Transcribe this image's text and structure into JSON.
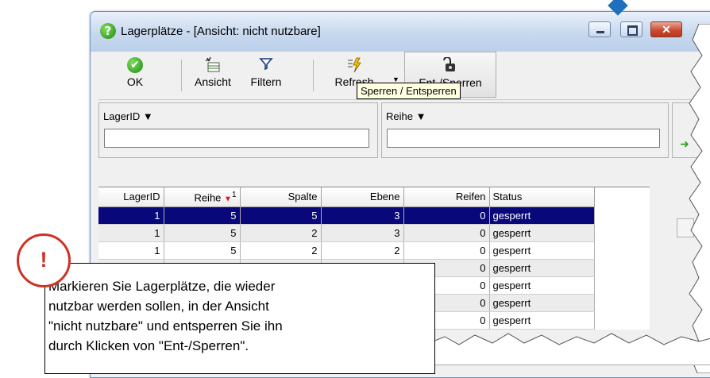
{
  "window": {
    "title": "Lagerplätze  -  [Ansicht: nicht nutzbare]",
    "title_icon": "question-icon",
    "controls": {
      "minimize": "minimize-icon",
      "maximize": "maximize-icon",
      "close": "✕"
    }
  },
  "toolbar": {
    "ok_label": "OK",
    "ansicht_label": "Ansicht",
    "filtern_label": "Filtern",
    "refresh_label": "Refresh",
    "sperren_label": "Ent-/Sperren",
    "icons": [
      "ok-check-icon",
      "view-icon",
      "filter-funnel-icon",
      "refresh-lightning-icon",
      "lock-unlock-icon"
    ]
  },
  "tooltip": {
    "text": "Sperren / Entsperren"
  },
  "filters": {
    "lagerid_label": "LagerID",
    "lagerid_value": "",
    "reihe_label": "Reihe",
    "reihe_value": ""
  },
  "grid": {
    "columns": [
      "LagerID",
      "Reihe",
      "Spalte",
      "Ebene",
      "Reifen",
      "Status"
    ],
    "sort": {
      "column": "Reihe",
      "order": "1",
      "direction": "descending"
    },
    "rows": [
      {
        "lagerid": "1",
        "reihe": "5",
        "spalte": "5",
        "ebene": "3",
        "reifen": "0",
        "status": "gesperrt"
      },
      {
        "lagerid": "1",
        "reihe": "5",
        "spalte": "2",
        "ebene": "3",
        "reifen": "0",
        "status": "gesperrt"
      },
      {
        "lagerid": "1",
        "reihe": "5",
        "spalte": "2",
        "ebene": "2",
        "reifen": "0",
        "status": "gesperrt"
      },
      {
        "lagerid": "",
        "reihe": "",
        "spalte": "",
        "ebene": "",
        "reifen": "0",
        "status": "gesperrt"
      },
      {
        "lagerid": "",
        "reihe": "",
        "spalte": "",
        "ebene": "",
        "reifen": "0",
        "status": "gesperrt"
      },
      {
        "lagerid": "",
        "reihe": "",
        "spalte": "",
        "ebene": "",
        "reifen": "0",
        "status": "gesperrt"
      },
      {
        "lagerid": "",
        "reihe": "",
        "spalte": "",
        "ebene": "",
        "reifen": "0",
        "status": "gesperrt"
      }
    ],
    "selected_row": 0
  },
  "callout": {
    "icon": "!",
    "lines": [
      "  Markieren Sie Lagerplätze, die wieder",
      "nutzbar werden sollen, in der Ansicht",
      "\"nicht nutzbare\" und entsperren Sie ihn",
      "durch Klicken von \"Ent-/Sperren\"."
    ]
  },
  "colors": {
    "selection": "#08087a",
    "alert": "#cf3124",
    "tooltip_bg": "#ffffe1",
    "marker": "#1f6fbf"
  }
}
